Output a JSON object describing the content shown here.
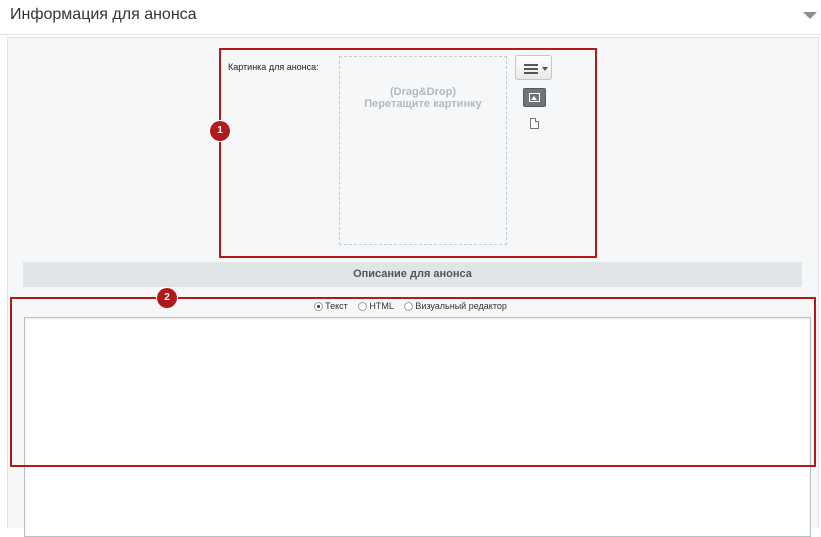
{
  "section": {
    "title": "Информация для анонса",
    "collapse_icon": "chevron-down-icon"
  },
  "image_block": {
    "label": "Картинка для анонса:",
    "dropzone_line1": "(Drag&Drop)",
    "dropzone_line2": "Перетащите картинку",
    "menu_icon": "menu-icon",
    "image_mode_icon": "image-icon",
    "file_mode_icon": "file-icon"
  },
  "description": {
    "header": "Описание для анонса",
    "modes": [
      "Текст",
      "HTML",
      "Визуальный редактор"
    ],
    "selected_mode": "Текст",
    "value": ""
  },
  "annotations": [
    "1",
    "2"
  ],
  "colors": {
    "annotation": "#b11a1a",
    "panel_bg": "#f5f7f8",
    "header_bar": "#e0e5e7"
  }
}
